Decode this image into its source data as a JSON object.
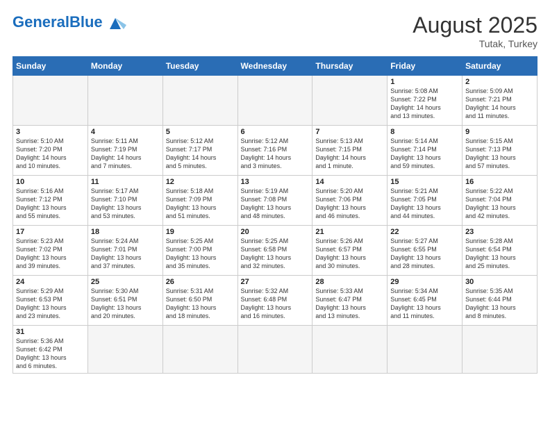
{
  "header": {
    "logo_general": "General",
    "logo_blue": "Blue",
    "month_year": "August 2025",
    "location": "Tutak, Turkey"
  },
  "weekdays": [
    "Sunday",
    "Monday",
    "Tuesday",
    "Wednesday",
    "Thursday",
    "Friday",
    "Saturday"
  ],
  "weeks": [
    [
      {
        "day": "",
        "info": ""
      },
      {
        "day": "",
        "info": ""
      },
      {
        "day": "",
        "info": ""
      },
      {
        "day": "",
        "info": ""
      },
      {
        "day": "",
        "info": ""
      },
      {
        "day": "1",
        "info": "Sunrise: 5:08 AM\nSunset: 7:22 PM\nDaylight: 14 hours\nand 13 minutes."
      },
      {
        "day": "2",
        "info": "Sunrise: 5:09 AM\nSunset: 7:21 PM\nDaylight: 14 hours\nand 11 minutes."
      }
    ],
    [
      {
        "day": "3",
        "info": "Sunrise: 5:10 AM\nSunset: 7:20 PM\nDaylight: 14 hours\nand 10 minutes."
      },
      {
        "day": "4",
        "info": "Sunrise: 5:11 AM\nSunset: 7:19 PM\nDaylight: 14 hours\nand 7 minutes."
      },
      {
        "day": "5",
        "info": "Sunrise: 5:12 AM\nSunset: 7:17 PM\nDaylight: 14 hours\nand 5 minutes."
      },
      {
        "day": "6",
        "info": "Sunrise: 5:12 AM\nSunset: 7:16 PM\nDaylight: 14 hours\nand 3 minutes."
      },
      {
        "day": "7",
        "info": "Sunrise: 5:13 AM\nSunset: 7:15 PM\nDaylight: 14 hours\nand 1 minute."
      },
      {
        "day": "8",
        "info": "Sunrise: 5:14 AM\nSunset: 7:14 PM\nDaylight: 13 hours\nand 59 minutes."
      },
      {
        "day": "9",
        "info": "Sunrise: 5:15 AM\nSunset: 7:13 PM\nDaylight: 13 hours\nand 57 minutes."
      }
    ],
    [
      {
        "day": "10",
        "info": "Sunrise: 5:16 AM\nSunset: 7:12 PM\nDaylight: 13 hours\nand 55 minutes."
      },
      {
        "day": "11",
        "info": "Sunrise: 5:17 AM\nSunset: 7:10 PM\nDaylight: 13 hours\nand 53 minutes."
      },
      {
        "day": "12",
        "info": "Sunrise: 5:18 AM\nSunset: 7:09 PM\nDaylight: 13 hours\nand 51 minutes."
      },
      {
        "day": "13",
        "info": "Sunrise: 5:19 AM\nSunset: 7:08 PM\nDaylight: 13 hours\nand 48 minutes."
      },
      {
        "day": "14",
        "info": "Sunrise: 5:20 AM\nSunset: 7:06 PM\nDaylight: 13 hours\nand 46 minutes."
      },
      {
        "day": "15",
        "info": "Sunrise: 5:21 AM\nSunset: 7:05 PM\nDaylight: 13 hours\nand 44 minutes."
      },
      {
        "day": "16",
        "info": "Sunrise: 5:22 AM\nSunset: 7:04 PM\nDaylight: 13 hours\nand 42 minutes."
      }
    ],
    [
      {
        "day": "17",
        "info": "Sunrise: 5:23 AM\nSunset: 7:02 PM\nDaylight: 13 hours\nand 39 minutes."
      },
      {
        "day": "18",
        "info": "Sunrise: 5:24 AM\nSunset: 7:01 PM\nDaylight: 13 hours\nand 37 minutes."
      },
      {
        "day": "19",
        "info": "Sunrise: 5:25 AM\nSunset: 7:00 PM\nDaylight: 13 hours\nand 35 minutes."
      },
      {
        "day": "20",
        "info": "Sunrise: 5:25 AM\nSunset: 6:58 PM\nDaylight: 13 hours\nand 32 minutes."
      },
      {
        "day": "21",
        "info": "Sunrise: 5:26 AM\nSunset: 6:57 PM\nDaylight: 13 hours\nand 30 minutes."
      },
      {
        "day": "22",
        "info": "Sunrise: 5:27 AM\nSunset: 6:55 PM\nDaylight: 13 hours\nand 28 minutes."
      },
      {
        "day": "23",
        "info": "Sunrise: 5:28 AM\nSunset: 6:54 PM\nDaylight: 13 hours\nand 25 minutes."
      }
    ],
    [
      {
        "day": "24",
        "info": "Sunrise: 5:29 AM\nSunset: 6:53 PM\nDaylight: 13 hours\nand 23 minutes."
      },
      {
        "day": "25",
        "info": "Sunrise: 5:30 AM\nSunset: 6:51 PM\nDaylight: 13 hours\nand 20 minutes."
      },
      {
        "day": "26",
        "info": "Sunrise: 5:31 AM\nSunset: 6:50 PM\nDaylight: 13 hours\nand 18 minutes."
      },
      {
        "day": "27",
        "info": "Sunrise: 5:32 AM\nSunset: 6:48 PM\nDaylight: 13 hours\nand 16 minutes."
      },
      {
        "day": "28",
        "info": "Sunrise: 5:33 AM\nSunset: 6:47 PM\nDaylight: 13 hours\nand 13 minutes."
      },
      {
        "day": "29",
        "info": "Sunrise: 5:34 AM\nSunset: 6:45 PM\nDaylight: 13 hours\nand 11 minutes."
      },
      {
        "day": "30",
        "info": "Sunrise: 5:35 AM\nSunset: 6:44 PM\nDaylight: 13 hours\nand 8 minutes."
      }
    ],
    [
      {
        "day": "31",
        "info": "Sunrise: 5:36 AM\nSunset: 6:42 PM\nDaylight: 13 hours\nand 6 minutes."
      },
      {
        "day": "",
        "info": ""
      },
      {
        "day": "",
        "info": ""
      },
      {
        "day": "",
        "info": ""
      },
      {
        "day": "",
        "info": ""
      },
      {
        "day": "",
        "info": ""
      },
      {
        "day": "",
        "info": ""
      }
    ]
  ]
}
